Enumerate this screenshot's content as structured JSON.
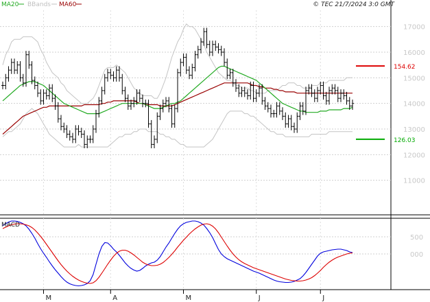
{
  "header": {
    "copyright": "© TEC 21/7/2024 3:0 GMT",
    "legend": [
      {
        "label": "MA20",
        "color": "#22aa22"
      },
      {
        "label": "BBands",
        "color": "#c0c0c0"
      },
      {
        "label": "MA60",
        "color": "#990000"
      }
    ]
  },
  "chart_data": [
    {
      "type": "ohlc",
      "ylim": [
        10000,
        17500
      ],
      "yticks": [
        "17000",
        "16000",
        "15000",
        "14000",
        "13000",
        "12000",
        "11000"
      ],
      "ytick_values": [
        17000,
        16000,
        15000,
        14000,
        13000,
        12000,
        11000
      ],
      "x_months": [
        {
          "label": "M",
          "index": 14
        },
        {
          "label": "A",
          "index": 37
        },
        {
          "label": "M",
          "index": 62
        },
        {
          "label": "J",
          "index": 87
        },
        {
          "label": "J",
          "index": 109
        }
      ],
      "levels": [
        {
          "label": "154.62",
          "value": 15462,
          "color": "#dd0000"
        },
        {
          "label": "126.03",
          "value": 12603,
          "color": "#00aa00"
        }
      ],
      "series": {
        "close": [
          14700,
          15000,
          15300,
          15600,
          15300,
          15500,
          15000,
          14800,
          15900,
          15500,
          14900,
          14700,
          14400,
          14100,
          14400,
          14300,
          14600,
          14200,
          13900,
          13400,
          13100,
          13000,
          12800,
          12700,
          12600,
          13000,
          12900,
          12800,
          12400,
          12600,
          12600,
          13000,
          13600,
          14100,
          14500,
          15000,
          15200,
          15100,
          15000,
          15300,
          15000,
          14500,
          14200,
          13900,
          14000,
          14100,
          14400,
          14200,
          14000,
          14000,
          13200,
          12400,
          12600,
          13500,
          13800,
          14000,
          14100,
          13800,
          13200,
          13800,
          15200,
          15600,
          15800,
          15300,
          15100,
          15400,
          15900,
          16100,
          16400,
          16800,
          16300,
          16000,
          16300,
          16200,
          16100,
          16000,
          15600,
          15100,
          15200,
          14800,
          14600,
          14400,
          14500,
          14400,
          14300,
          14700,
          14200,
          14400,
          14600,
          14100,
          13900,
          13800,
          13600,
          13600,
          13900,
          13700,
          13500,
          13200,
          13400,
          13100,
          13000,
          13500,
          13900,
          13700,
          14500,
          14600,
          14400,
          14200,
          14500,
          14700,
          14300,
          14100,
          14500,
          14600,
          14500,
          14200,
          14400,
          14300,
          14100,
          13900,
          14000
        ]
      },
      "bb_upper": [
        15500,
        15900,
        16100,
        16400,
        16500,
        16500,
        16500,
        16600,
        16600,
        16600,
        16600,
        16500,
        16400,
        16100,
        15900,
        15600,
        15400,
        15200,
        15100,
        15000,
        14800,
        14700,
        14500,
        14400,
        14300,
        14200,
        14100,
        14000,
        14000,
        14000,
        14100,
        14200,
        14400,
        14700,
        15000,
        15300,
        15400,
        15400,
        15400,
        15500,
        15400,
        15300,
        15200,
        15000,
        14800,
        14600,
        14500,
        14400,
        14300,
        14300,
        14300,
        14300,
        14200,
        14200,
        14400,
        14700,
        15000,
        15400,
        15800,
        16100,
        16400,
        16600,
        16900,
        17100,
        17000,
        17000,
        16900,
        16700,
        16500,
        16300,
        16000,
        15800,
        15600,
        15400,
        15200,
        15100,
        15000,
        14900,
        14900,
        14800,
        14700,
        14700,
        14600,
        14600,
        14600,
        14500,
        14500,
        14400,
        14400,
        14400,
        14400,
        14500,
        14500,
        14500,
        14500,
        14600,
        14700,
        14700,
        14800,
        14800,
        14800,
        14700,
        14700,
        14600,
        14600,
        14600,
        14700,
        14700,
        14700,
        14800,
        14800,
        14800,
        14900,
        14900,
        14900,
        14900,
        14900,
        14900,
        15000,
        15000,
        15000
      ],
      "bb_lower": [
        12700,
        12800,
        12900,
        12900,
        13000,
        13100,
        13200,
        13400,
        13600,
        13700,
        13800,
        13700,
        13600,
        13400,
        13200,
        13000,
        12800,
        12700,
        12600,
        12500,
        12400,
        12300,
        12300,
        12300,
        12300,
        12300,
        12400,
        12300,
        12300,
        12300,
        12300,
        12300,
        12300,
        12300,
        12300,
        12300,
        12300,
        12400,
        12500,
        12600,
        12700,
        12700,
        12800,
        12800,
        12800,
        12900,
        12900,
        13000,
        13000,
        13000,
        12900,
        12900,
        12900,
        12900,
        12800,
        12800,
        12700,
        12700,
        12600,
        12600,
        12500,
        12400,
        12400,
        12300,
        12300,
        12300,
        12300,
        12300,
        12300,
        12300,
        12400,
        12500,
        12600,
        12800,
        13000,
        13200,
        13400,
        13600,
        13700,
        13700,
        13700,
        13700,
        13700,
        13600,
        13600,
        13500,
        13500,
        13400,
        13300,
        13200,
        13100,
        13000,
        12900,
        12900,
        12800,
        12800,
        12800,
        12700,
        12700,
        12700,
        12700,
        12700,
        12700,
        12700,
        12700,
        12700,
        12800,
        12800,
        12800,
        12800,
        12800,
        12800,
        12900,
        12900,
        12900,
        12900,
        12900,
        12900,
        12900,
        12900,
        12900
      ],
      "ma20": [
        14100,
        14200,
        14300,
        14400,
        14500,
        14600,
        14700,
        14750,
        14800,
        14850,
        14850,
        14850,
        14800,
        14750,
        14700,
        14600,
        14500,
        14400,
        14300,
        14200,
        14100,
        14000,
        13950,
        13900,
        13850,
        13800,
        13750,
        13700,
        13650,
        13600,
        13600,
        13600,
        13600,
        13600,
        13650,
        13700,
        13750,
        13800,
        13850,
        13900,
        13950,
        14000,
        14000,
        14000,
        14000,
        14000,
        14000,
        14000,
        14000,
        13950,
        13900,
        13850,
        13800,
        13800,
        13800,
        13850,
        13900,
        13950,
        14000,
        14000,
        14050,
        14100,
        14200,
        14300,
        14400,
        14500,
        14600,
        14700,
        14800,
        14900,
        15000,
        15100,
        15200,
        15300,
        15400,
        15450,
        15450,
        15400,
        15350,
        15300,
        15250,
        15200,
        15150,
        15100,
        15050,
        15000,
        14950,
        14900,
        14800,
        14700,
        14600,
        14500,
        14400,
        14300,
        14200,
        14100,
        14000,
        13950,
        13900,
        13850,
        13800,
        13750,
        13700,
        13700,
        13650,
        13650,
        13650,
        13650,
        13650,
        13700,
        13700,
        13700,
        13750,
        13750,
        13750,
        13750,
        13750,
        13800,
        13800,
        13800,
        13850
      ],
      "ma60": [
        12800,
        12900,
        13000,
        13100,
        13200,
        13300,
        13400,
        13500,
        13550,
        13600,
        13650,
        13700,
        13750,
        13800,
        13850,
        13850,
        13900,
        13900,
        13900,
        13900,
        13900,
        13900,
        13900,
        13900,
        13900,
        13900,
        13900,
        13900,
        13950,
        13950,
        13950,
        13950,
        13950,
        13950,
        14000,
        14000,
        14050,
        14050,
        14100,
        14100,
        14100,
        14100,
        14100,
        14100,
        14100,
        14100,
        14050,
        14000,
        14000,
        13950,
        13950,
        13950,
        13950,
        13950,
        13900,
        13900,
        13900,
        13900,
        13900,
        13950,
        14000,
        14050,
        14100,
        14150,
        14200,
        14250,
        14300,
        14350,
        14400,
        14450,
        14500,
        14550,
        14600,
        14650,
        14700,
        14750,
        14800,
        14800,
        14800,
        14800,
        14800,
        14800,
        14800,
        14800,
        14800,
        14750,
        14700,
        14700,
        14650,
        14650,
        14600,
        14600,
        14600,
        14550,
        14550,
        14500,
        14500,
        14450,
        14450,
        14450,
        14450,
        14400,
        14400,
        14400,
        14400,
        14400,
        14400,
        14400,
        14400,
        14400,
        14400,
        14400,
        14400,
        14400,
        14400,
        14400,
        14400,
        14400,
        14400,
        14400,
        14400
      ]
    },
    {
      "type": "line",
      "title": "MACD",
      "ylim": [
        -1000,
        1000
      ],
      "yticks": [
        "500",
        "000"
      ],
      "ytick_values": [
        500,
        0
      ],
      "series": [
        {
          "color": "#0000dd",
          "values": [
            830,
            880,
            930,
            960,
            960,
            950,
            920,
            880,
            820,
            720,
            600,
            460,
            300,
            150,
            20,
            -100,
            -230,
            -350,
            -460,
            -560,
            -660,
            -750,
            -820,
            -870,
            -900,
            -920,
            -930,
            -920,
            -900,
            -860,
            -780,
            -600,
            -300,
            0,
            220,
            330,
            320,
            240,
            140,
            60,
            -40,
            -150,
            -260,
            -350,
            -420,
            -470,
            -500,
            -480,
            -420,
            -350,
            -300,
            -260,
            -240,
            -180,
            -80,
            60,
            200,
            320,
            460,
            600,
            720,
            820,
            880,
            920,
            940,
            960,
            960,
            940,
            900,
            840,
            740,
            620,
            480,
            300,
            130,
            0,
            -80,
            -140,
            -180,
            -220,
            -260,
            -300,
            -340,
            -380,
            -420,
            -460,
            -500,
            -530,
            -560,
            -600,
            -640,
            -680,
            -720,
            -760,
            -790,
            -810,
            -820,
            -830,
            -830,
            -820,
            -800,
            -760,
            -720,
            -640,
            -540,
            -420,
            -300,
            -180,
            -60,
            20,
            60,
            80,
            100,
            120,
            130,
            140,
            140,
            120,
            100,
            60,
            40
          ]
        },
        {
          "color": "#dd0000",
          "values": [
            740,
            780,
            820,
            850,
            870,
            880,
            880,
            870,
            850,
            820,
            770,
            700,
            610,
            510,
            400,
            280,
            160,
            40,
            -80,
            -200,
            -310,
            -410,
            -500,
            -580,
            -650,
            -710,
            -760,
            -800,
            -830,
            -850,
            -860,
            -840,
            -780,
            -680,
            -560,
            -430,
            -300,
            -180,
            -70,
            20,
            80,
            110,
            110,
            80,
            30,
            -30,
            -100,
            -170,
            -240,
            -290,
            -320,
            -340,
            -340,
            -330,
            -300,
            -250,
            -180,
            -100,
            -10,
            90,
            200,
            300,
            400,
            490,
            580,
            660,
            730,
            790,
            840,
            870,
            880,
            860,
            810,
            730,
            620,
            490,
            360,
            230,
            110,
            0,
            -90,
            -170,
            -230,
            -280,
            -320,
            -360,
            -400,
            -430,
            -460,
            -490,
            -520,
            -550,
            -580,
            -610,
            -640,
            -670,
            -700,
            -730,
            -750,
            -770,
            -780,
            -790,
            -790,
            -780,
            -760,
            -730,
            -690,
            -630,
            -560,
            -480,
            -390,
            -310,
            -240,
            -180,
            -130,
            -90,
            -60,
            -30,
            0,
            20,
            30
          ]
        }
      ]
    }
  ]
}
